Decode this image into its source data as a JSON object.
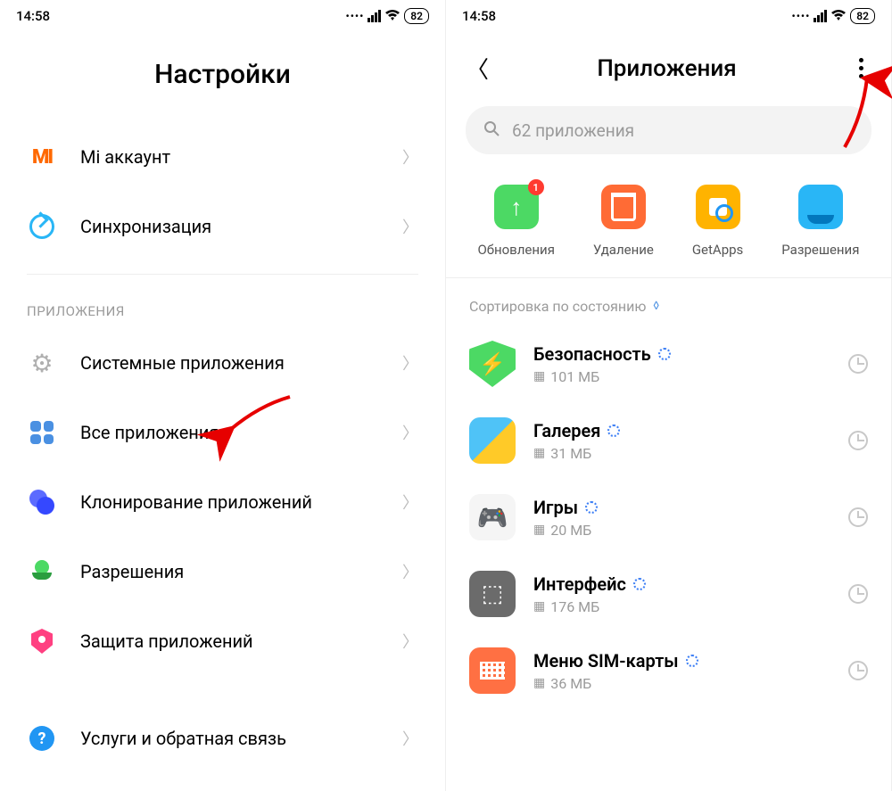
{
  "status": {
    "time": "14:58",
    "battery": "82"
  },
  "left": {
    "title": "Настройки",
    "account": [
      {
        "label": "Mi аккаунт"
      },
      {
        "label": "Синхронизация"
      }
    ],
    "section_apps": "ПРИЛОЖЕНИЯ",
    "apps": [
      {
        "label": "Системные приложения"
      },
      {
        "label": "Все приложения"
      },
      {
        "label": "Клонирование приложений"
      },
      {
        "label": "Разрешения"
      },
      {
        "label": "Защита приложений"
      }
    ],
    "help": {
      "label": "Услуги и обратная связь"
    }
  },
  "right": {
    "title": "Приложения",
    "search_placeholder": "62 приложения",
    "actions": [
      {
        "label": "Обновления",
        "badge": "1"
      },
      {
        "label": "Удаление"
      },
      {
        "label": "GetApps"
      },
      {
        "label": "Разрешения"
      }
    ],
    "sort": "Сортировка по состоянию",
    "list": [
      {
        "name": "Безопасность",
        "size": "101 МБ"
      },
      {
        "name": "Галерея",
        "size": "31 МБ"
      },
      {
        "name": "Игры",
        "size": "20 МБ"
      },
      {
        "name": "Интерфейс",
        "size": "176 МБ"
      },
      {
        "name": "Меню SIM-карты",
        "size": "36 МБ"
      }
    ]
  }
}
